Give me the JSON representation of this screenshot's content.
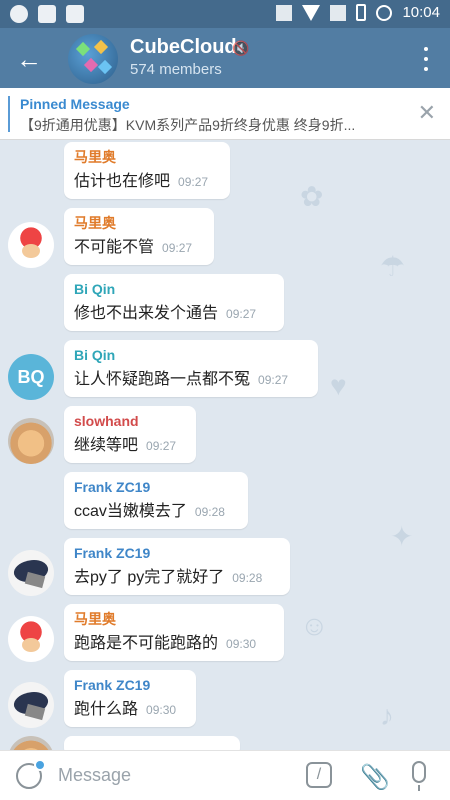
{
  "status_bar": {
    "time": "10:04"
  },
  "header": {
    "back_icon": "←",
    "chat_title": "CubeCloud",
    "members": "574 members",
    "mute_icon": "muted-icon",
    "menu_icon": "more-vertical-icon"
  },
  "pinned": {
    "title": "Pinned Message",
    "text": "【9折通用优惠】KVM系列产品9折终身优惠 终身9折...",
    "close": "✕"
  },
  "messages": [
    {
      "name": "马里奥",
      "name_color": "#e07b2a",
      "text": "估计也在修吧",
      "time": "09:27",
      "avatar": ""
    },
    {
      "name": "马里奥",
      "name_color": "#e07b2a",
      "text": "不可能不管",
      "time": "09:27",
      "avatar": "mario"
    },
    {
      "name": "Bi Qin",
      "name_color": "#2fa6b8",
      "text": "修也不出来发个通告",
      "time": "09:27",
      "avatar": ""
    },
    {
      "name": "Bi Qin",
      "name_color": "#2fa6b8",
      "text": "让人怀疑跑路一点都不冤",
      "time": "09:27",
      "avatar": "BQ"
    },
    {
      "name": "slowhand",
      "name_color": "#d24b4b",
      "text": "继续等吧",
      "time": "09:27",
      "avatar": "cat"
    },
    {
      "name": "Frank ZC19",
      "name_color": "#3f86c8",
      "text": "ccav当嫩模去了",
      "time": "09:28",
      "avatar": ""
    },
    {
      "name": "Frank ZC19",
      "name_color": "#3f86c8",
      "text": "去py了 py完了就好了",
      "time": "09:28",
      "avatar": "frank"
    },
    {
      "name": "马里奥",
      "name_color": "#e07b2a",
      "text": "跑路是不可能跑路的",
      "time": "09:30",
      "avatar": "mario"
    },
    {
      "name": "Frank ZC19",
      "name_color": "#3f86c8",
      "text": "跑什么路",
      "time": "09:30",
      "avatar": "frank"
    }
  ],
  "composer": {
    "placeholder": "Message"
  }
}
